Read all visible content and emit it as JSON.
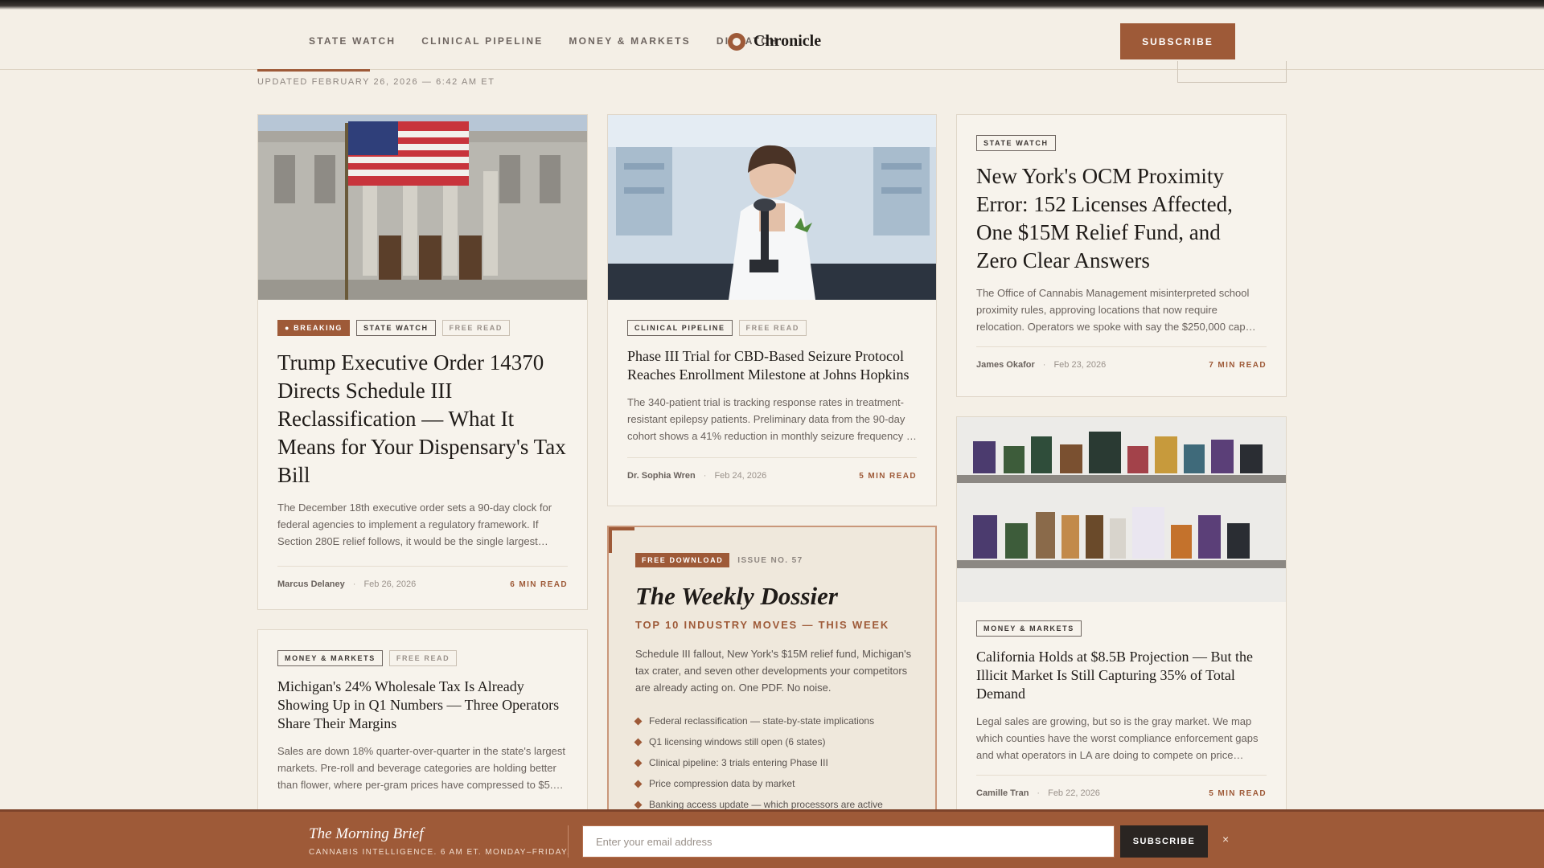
{
  "nav": {
    "items": [
      "STATE WATCH",
      "CLINICAL PIPELINE",
      "MONEY & MARKETS",
      "DISPATCH"
    ],
    "brand": "Chronicle",
    "subscribe_label": "SUBSCRIBE"
  },
  "section": {
    "updated": "UPDATED FEBRUARY 26, 2026 — 6:42 AM ET"
  },
  "cards": {
    "trump": {
      "tags": [
        "● BREAKING",
        "STATE WATCH",
        "FREE READ"
      ],
      "headline": "Trump Executive Order 14370 Directs Schedule III Reclassification — What It Means for Your Dispensary's Tax Bill",
      "dek": "The December 18th executive order sets a 90-day clock for federal agencies to implement a regulatory framework. If Section 280E relief follows, it would be the single largest…",
      "author": "Marcus Delaney",
      "date": "Feb 26, 2026",
      "read": "6 MIN READ"
    },
    "cbd": {
      "tags": [
        "CLINICAL PIPELINE",
        "FREE READ"
      ],
      "headline": "Phase III Trial for CBD-Based Seizure Protocol Reaches Enrollment Milestone at Johns Hopkins",
      "dek": "The 340-patient trial is tracking response rates in treatment-resistant epilepsy patients. Preliminary data from the 90-day cohort shows a 41% reduction in monthly seizure frequency …",
      "author": "Dr. Sophia Wren",
      "date": "Feb 24, 2026",
      "read": "5 MIN READ"
    },
    "ny": {
      "tags": [
        "STATE WATCH"
      ],
      "headline": "New York's OCM Proximity Error: 152 Licenses Affected, One $15M Relief Fund, and Zero Clear Answers",
      "dek": "The Office of Cannabis Management misinterpreted school proximity rules, approving locations that now require relocation. Operators we spoke with say the $250,000 cap…",
      "author": "James Okafor",
      "date": "Feb 23, 2026",
      "read": "7 MIN READ"
    },
    "michigan": {
      "tags": [
        "MONEY & MARKETS",
        "FREE READ"
      ],
      "headline": "Michigan's 24% Wholesale Tax Is Already Showing Up in Q1 Numbers — Three Operators Share Their Margins",
      "dek": "Sales are down 18% quarter-over-quarter in the state's largest markets. Pre-roll and beverage categories are holding better than flower, where per-gram prices have compressed to $5.…"
    },
    "california": {
      "tags": [
        "MONEY & MARKETS"
      ],
      "headline": "California Holds at $8.5B Projection — But the Illicit Market Is Still Capturing 35% of Total Demand",
      "dek": "Legal sales are growing, but so is the gray market. We map which counties have the worst compliance enforcement gaps and what operators in LA are doing to compete on price…",
      "author": "Camille Tran",
      "date": "Feb 22, 2026",
      "read": "5 MIN READ"
    }
  },
  "dossier": {
    "badge": "FREE DOWNLOAD",
    "issue": "ISSUE NO. 57",
    "title": "The Weekly Dossier",
    "subtitle": "TOP 10 INDUSTRY MOVES — THIS WEEK",
    "dek": "Schedule III fallout, New York's $15M relief fund, Michigan's tax crater, and seven other developments your competitors are already acting on. One PDF. No noise.",
    "items": [
      "Federal reclassification — state-by-state implications",
      "Q1 licensing windows still open (6 states)",
      "Clinical pipeline: 3 trials entering Phase III",
      "Price compression data by market",
      "Banking access update — which processors are active"
    ]
  },
  "brief": {
    "title": "The Morning Brief",
    "subtitle": "CANNABIS INTELLIGENCE. 6 AM ET. MONDAY–FRIDAY.",
    "placeholder": "Enter your email address",
    "button": "SUBSCRIBE",
    "close": "×"
  },
  "colors": {
    "accent": "#9e5a38",
    "background": "#f4efe6",
    "ink": "#1f1b18"
  }
}
